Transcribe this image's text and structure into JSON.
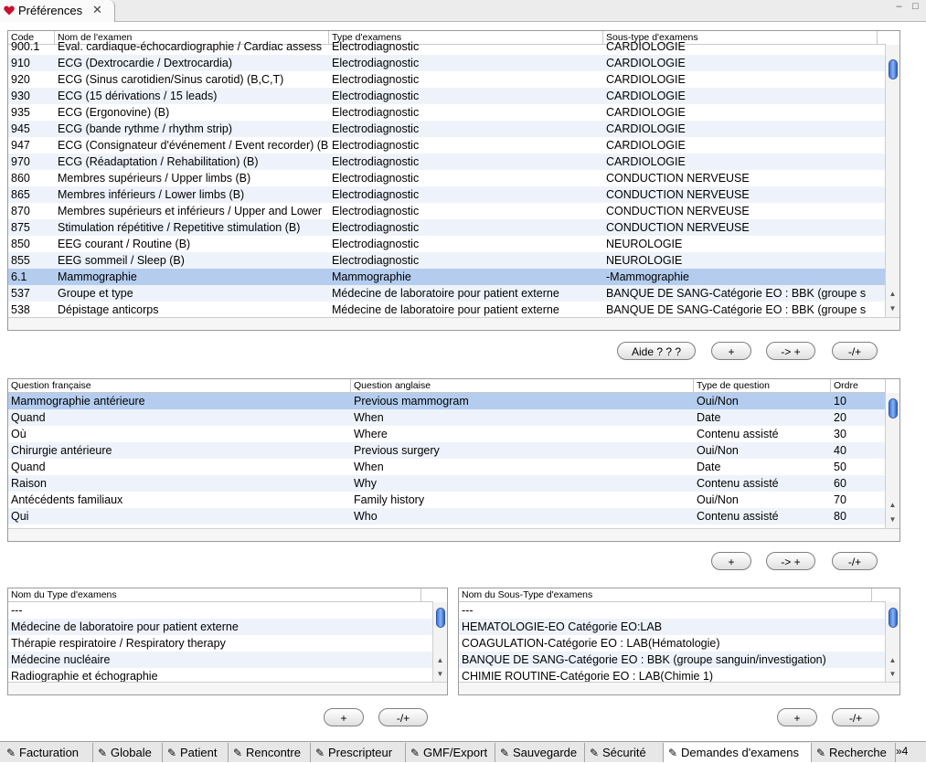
{
  "window": {
    "tab_title": "Préférences",
    "close_glyph": "✕",
    "minimize_glyph": "–",
    "maximize_glyph": "□"
  },
  "exams_table": {
    "headers": [
      "Code",
      "Nom de l'examen",
      "Type d'examens",
      "Sous-type d'examens"
    ],
    "rows": [
      [
        "900.1",
        "Eval. cardiaque-échocardiographie / Cardiac assess",
        "Electrodiagnostic",
        "CARDIOLOGIE"
      ],
      [
        "910",
        "ECG (Dextrocardie / Dextrocardia)",
        "Electrodiagnostic",
        "CARDIOLOGIE"
      ],
      [
        "920",
        "ECG (Sinus carotidien/Sinus carotid) (B,C,T)",
        "Electrodiagnostic",
        "CARDIOLOGIE"
      ],
      [
        "930",
        "ECG (15 dérivations / 15 leads)",
        "Electrodiagnostic",
        "CARDIOLOGIE"
      ],
      [
        "935",
        "ECG (Ergonovine) (B)",
        "Electrodiagnostic",
        "CARDIOLOGIE"
      ],
      [
        "945",
        "ECG (bande rythme / rhythm strip)",
        "Electrodiagnostic",
        "CARDIOLOGIE"
      ],
      [
        "947",
        "ECG (Consignateur d'événement / Event recorder) (B",
        "Electrodiagnostic",
        "CARDIOLOGIE"
      ],
      [
        "970",
        "ECG (Réadaptation / Rehabilitation) (B)",
        "Electrodiagnostic",
        "CARDIOLOGIE"
      ],
      [
        "860",
        "Membres supérieurs / Upper limbs (B)",
        "Electrodiagnostic",
        "CONDUCTION NERVEUSE"
      ],
      [
        "865",
        "Membres inférieurs / Lower limbs (B)",
        "Electrodiagnostic",
        "CONDUCTION NERVEUSE"
      ],
      [
        "870",
        "Membres supérieurs et inférieurs / Upper and Lower",
        "Electrodiagnostic",
        "CONDUCTION NERVEUSE"
      ],
      [
        "875",
        "Stimulation répétitive / Repetitive stimulation (B)",
        "Electrodiagnostic",
        "CONDUCTION NERVEUSE"
      ],
      [
        "850",
        "EEG courant / Routine (B)",
        "Electrodiagnostic",
        "NEUROLOGIE"
      ],
      [
        "855",
        "EEG sommeil / Sleep (B)",
        "Electrodiagnostic",
        "NEUROLOGIE"
      ],
      [
        "6.1",
        "Mammographie",
        "Mammographie",
        "-Mammographie"
      ],
      [
        "537",
        "Groupe et type",
        "Médecine de laboratoire pour patient externe",
        "BANQUE DE SANG-Catégorie EO : BBK (groupe s"
      ],
      [
        "538",
        "Dépistage anticorps",
        "Médecine de laboratoire pour patient externe",
        "BANQUE DE SANG-Catégorie EO : BBK (groupe s"
      ]
    ],
    "selected_index": 14,
    "buttons": [
      "Aide ? ? ?",
      "+",
      "-> +",
      "-/+"
    ]
  },
  "questions_table": {
    "headers": [
      "Question française",
      "Question anglaise",
      "Type de question",
      "Ordre"
    ],
    "rows": [
      [
        "Mammographie antérieure",
        "Previous mammogram",
        "Oui/Non",
        "10"
      ],
      [
        "  Quand",
        "  When",
        "Date",
        "20"
      ],
      [
        "  Où",
        "  Where",
        "Contenu assisté",
        "30"
      ],
      [
        "Chirurgie antérieure",
        "Previous surgery",
        "Oui/Non",
        "40"
      ],
      [
        "  Quand",
        "  When",
        "Date",
        "50"
      ],
      [
        "  Raison",
        "  Why",
        "Contenu assisté",
        "60"
      ],
      [
        "Antécédents familiaux",
        "Family history",
        "Oui/Non",
        "70"
      ],
      [
        "  Qui",
        "  Who",
        "Contenu assisté",
        "80"
      ]
    ],
    "selected_index": 0,
    "buttons": [
      "+",
      "-> +",
      "-/+"
    ]
  },
  "types_table": {
    "header": "Nom du Type d'examens",
    "rows": [
      "---",
      "Médecine de laboratoire pour patient externe",
      "Thérapie respiratoire / Respiratory therapy",
      "Médecine nucléaire",
      "Radiographie et échographie"
    ],
    "buttons": [
      "+",
      "-/+"
    ]
  },
  "subtypes_table": {
    "header": "Nom du Sous-Type d'examens",
    "rows": [
      "---",
      "HEMATOLOGIE-EO Catégorie EO:LAB",
      "COAGULATION-Catégorie EO : LAB(Hématologie)",
      "BANQUE DE SANG-Catégorie EO : BBK (groupe sanguin/investigation)",
      "CHIMIE ROUTINE-Catégorie EO : LAB(Chimie 1)"
    ],
    "buttons": [
      "+",
      "-/+"
    ]
  },
  "bottom_tabs": {
    "items": [
      "Facturation",
      "Globale",
      "Patient",
      "Rencontre",
      "Prescripteur",
      "GMF/Export",
      "Sauvegarde",
      "Sécurité",
      "Demandes d'examens",
      "Recherche"
    ],
    "active_index": 8,
    "overflow_label": "»4"
  },
  "colors": {
    "selection": "#b4cdef",
    "alt_row": "#eef3fb",
    "heart": "#c8102e",
    "scroll_thumb": "#3c74d8"
  }
}
